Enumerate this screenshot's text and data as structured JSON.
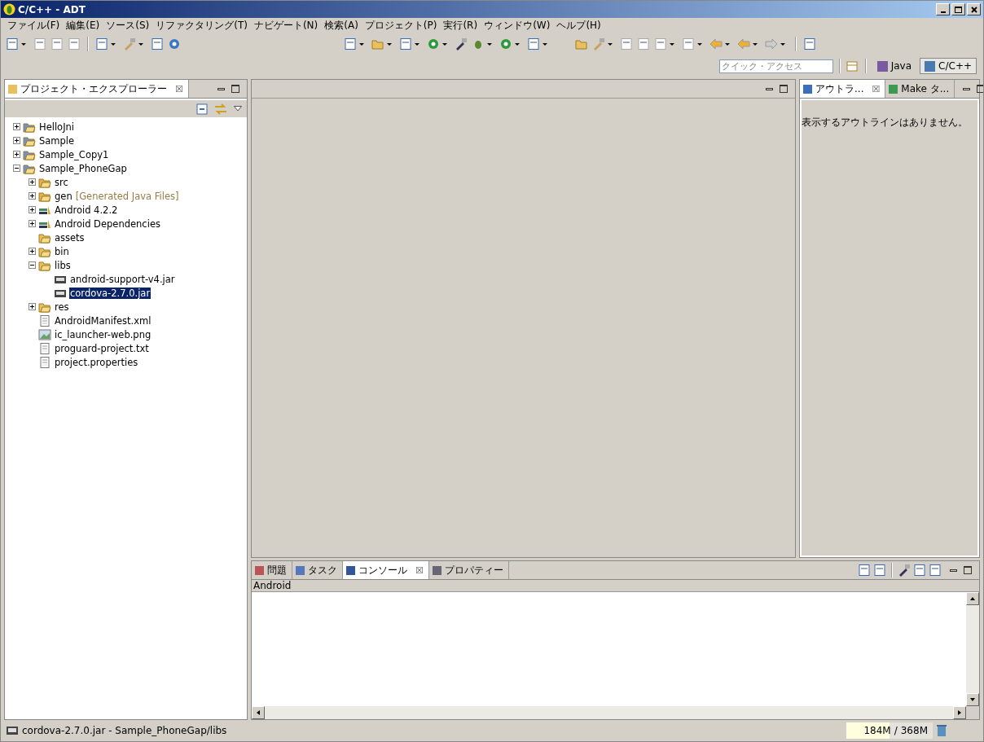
{
  "window": {
    "title": "C/C++ - ADT"
  },
  "menu": [
    "ファイル(F)",
    "編集(E)",
    "ソース(S)",
    "リファクタリング(T)",
    "ナビゲート(N)",
    "検索(A)",
    "プロジェクト(P)",
    "実行(R)",
    "ウィンドウ(W)",
    "ヘルプ(H)"
  ],
  "quick_access": {
    "placeholder": "クイック・アクセス"
  },
  "perspectives": [
    {
      "label": "Java",
      "selected": false
    },
    {
      "label": "C/C++",
      "selected": true
    }
  ],
  "explorer": {
    "tab": "プロジェクト・エクスプローラー",
    "close": "☒",
    "tree": [
      {
        "label": "HelloJni",
        "kind": "project",
        "expanded": false,
        "selected": false
      },
      {
        "label": "Sample",
        "kind": "project",
        "expanded": false,
        "selected": false
      },
      {
        "label": "Sample_Copy1",
        "kind": "project",
        "expanded": false,
        "selected": false
      },
      {
        "label": "Sample_PhoneGap",
        "kind": "project",
        "expanded": true,
        "selected": false,
        "children": [
          {
            "label": "src",
            "kind": "package",
            "expanded": false,
            "selected": false
          },
          {
            "label": "gen",
            "decoration": "[Generated Java Files]",
            "kind": "package",
            "expanded": false,
            "selected": false
          },
          {
            "label": "Android 4.2.2",
            "kind": "library",
            "expanded": false,
            "selected": false
          },
          {
            "label": "Android Dependencies",
            "kind": "library",
            "expanded": false,
            "selected": false
          },
          {
            "label": "assets",
            "kind": "folder",
            "selected": false
          },
          {
            "label": "bin",
            "kind": "folder",
            "expanded": false,
            "selected": false
          },
          {
            "label": "libs",
            "kind": "folder",
            "expanded": true,
            "selected": false,
            "children": [
              {
                "label": "android-support-v4.jar",
                "kind": "jar",
                "selected": false
              },
              {
                "label": "cordova-2.7.0.jar",
                "kind": "jar",
                "selected": true
              }
            ]
          },
          {
            "label": "res",
            "kind": "folder",
            "expanded": false,
            "selected": false
          },
          {
            "label": "AndroidManifest.xml",
            "kind": "manifest",
            "selected": false
          },
          {
            "label": "ic_launcher-web.png",
            "kind": "image",
            "selected": false
          },
          {
            "label": "proguard-project.txt",
            "kind": "file",
            "selected": false
          },
          {
            "label": "project.properties",
            "kind": "file",
            "selected": false
          }
        ]
      }
    ]
  },
  "outline": {
    "tabs": [
      {
        "label": "アウトラ...",
        "kind": "outline",
        "selected": true,
        "close": "☒"
      },
      {
        "label": "Make タ...",
        "kind": "make",
        "selected": false
      }
    ],
    "message": "表示するアウトラインはありません。"
  },
  "console": {
    "tabs": [
      {
        "label": "問題",
        "kind": "problems",
        "selected": false
      },
      {
        "label": "タスク",
        "kind": "tasks",
        "selected": false
      },
      {
        "label": "コンソール",
        "kind": "console",
        "selected": true,
        "close": "☒"
      },
      {
        "label": "プロパティー",
        "kind": "properties",
        "selected": false
      }
    ],
    "header": "Android"
  },
  "status_bar": {
    "text": "cordova-2.7.0.jar - Sample_PhoneGap/libs",
    "heap": {
      "used": "184M",
      "separator": "/",
      "total": "368M",
      "level": 0.5
    }
  }
}
